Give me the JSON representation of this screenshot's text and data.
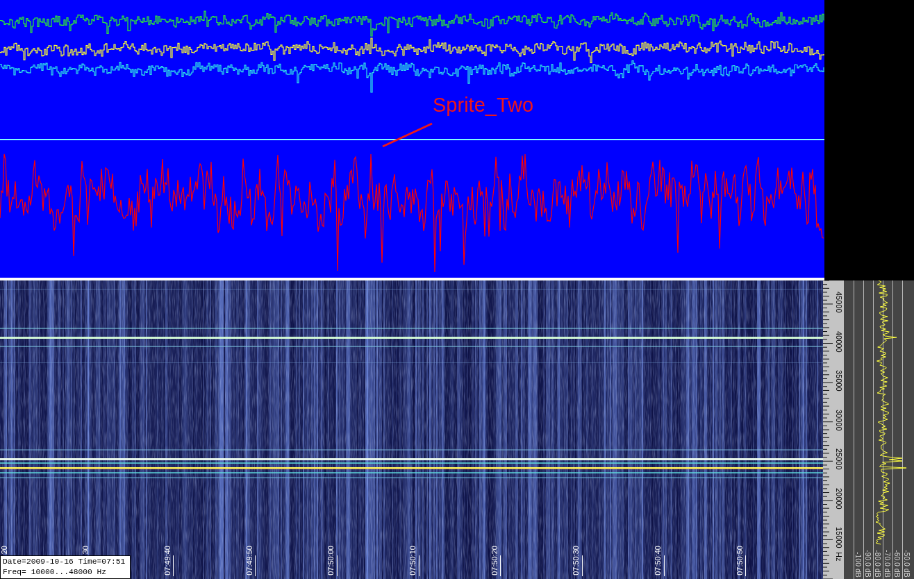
{
  "waveform_panel": {
    "annotation": "Sprite_Two"
  },
  "spectrogram": {
    "time_labels": [
      "20",
      "30",
      "07:49:40",
      "07:49:50",
      "07:50:00",
      "07:50:10",
      "07:50:20",
      "07:50:30",
      "07:50:40",
      "07:50:50"
    ],
    "info": [
      "Date=2009-10-16 Time=07:51",
      "Freq= 10000...48000 Hz"
    ]
  },
  "frequency_axis": {
    "labels": [
      "45000",
      "40000",
      "35000",
      "30000",
      "25000",
      "20000",
      "15000"
    ],
    "unit": "Hz"
  },
  "spectrum_panel": {
    "db_labels": [
      "-100 dB",
      "-90.0 dB",
      "-80.0 dB",
      "-70.0 dB",
      "-60.0 dB",
      "-50.0 dB"
    ]
  }
}
